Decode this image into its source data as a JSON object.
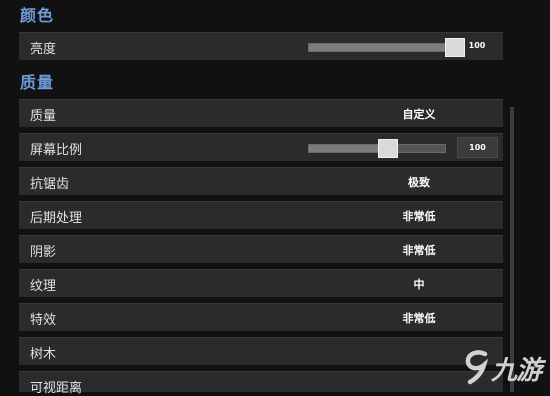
{
  "sections": {
    "color": {
      "title": "颜色"
    },
    "quality": {
      "title": "质量"
    }
  },
  "rows": {
    "brightness": {
      "label": "亮度",
      "level": 100,
      "value_text": "100"
    },
    "quality_preset": {
      "label": "质量",
      "value": "自定义"
    },
    "screen_ratio": {
      "label": "屏幕比例",
      "level": 100,
      "value_text": "100"
    },
    "anti_aliasing": {
      "label": "抗锯齿",
      "value": "极致"
    },
    "post_processing": {
      "label": "后期处理",
      "value": "非常低"
    },
    "shadows": {
      "label": "阴影",
      "value": "非常低"
    },
    "textures": {
      "label": "纹理",
      "value": "中"
    },
    "effects": {
      "label": "特效",
      "value": "非常低"
    },
    "foliage": {
      "label": "树木",
      "value": ""
    },
    "view_distance": {
      "label": "可视距离",
      "value": ""
    }
  },
  "watermark": {
    "text": "九游",
    "icon": "9-logo-icon"
  },
  "colors": {
    "accent": "#6f9bd8",
    "row_bg": "#2b2b2d",
    "page_bg": "#111112"
  }
}
